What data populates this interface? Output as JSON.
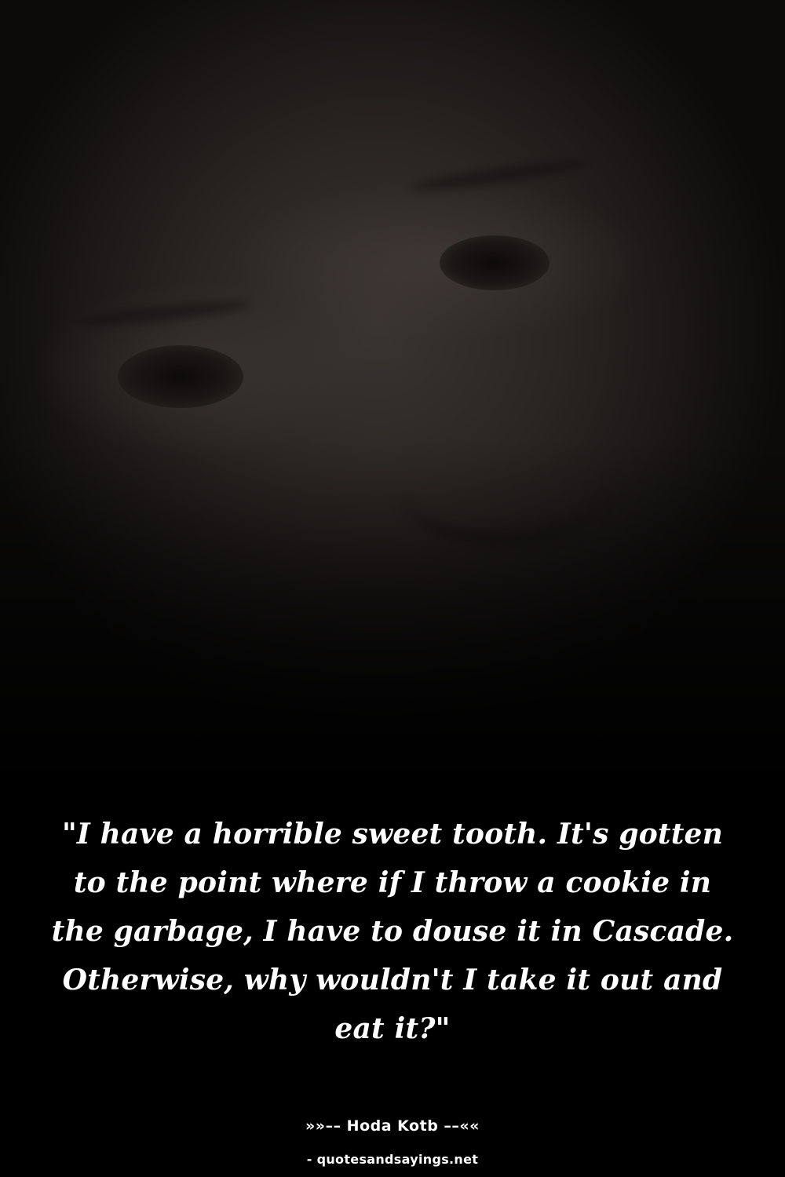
{
  "quote": {
    "text": "\"I have a horrible sweet tooth. It's gotten to the point where if I throw a cookie in the garbage, I have to douse it in Cascade. Otherwise, why wouldn't I take it out and eat it?\""
  },
  "author": {
    "line": "»»–– Hoda Kotb ––««"
  },
  "source": {
    "text": "- quotesandsayings.net"
  },
  "colors": {
    "background": "#000000",
    "text": "#ffffff"
  }
}
